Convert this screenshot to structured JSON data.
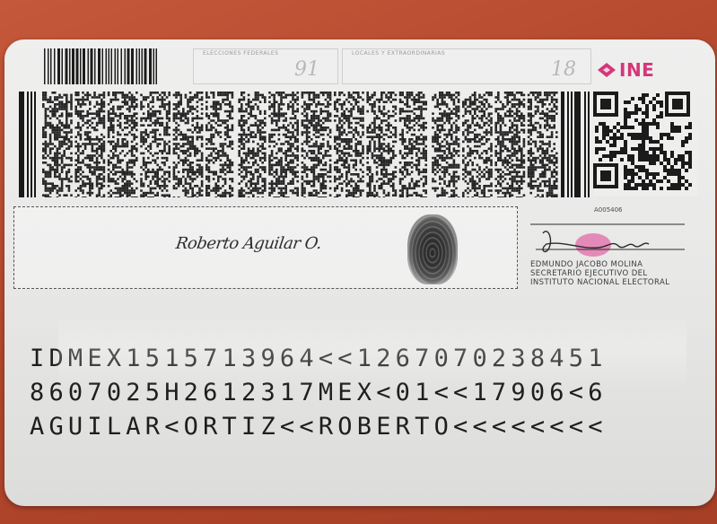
{
  "card": {
    "field1_label": "ELECCIONES FEDERALES",
    "field1_value": "91",
    "field2_label": "LOCALES Y EXTRAORDINARIAS",
    "field2_value": "18",
    "logo_text": "INE",
    "serial": "A005406",
    "signature_text": "Roberto Aguilar O.",
    "signatory_lines": [
      "EDMUNDO JACOBO MOLINA",
      "SECRETARIO EJECUTIVO DEL",
      "INSTITUTO NACIONAL ELECTORAL"
    ],
    "mrz": [
      "IDMEX1515713964<<1267070238451",
      "8607025H2612317MEX<01<<17906<6",
      "AGUILAR<ORTIZ<<ROBERTO<<<<<<<<"
    ]
  },
  "colors": {
    "background": "#b84c30",
    "card": "#ebebea",
    "logo": "#d4377a",
    "ink": "#1e1e1e"
  },
  "icons": [
    "barcode-small",
    "pdf417-barcode",
    "qr-code",
    "fingerprint",
    "ine-logo-mark",
    "official-signature"
  ]
}
